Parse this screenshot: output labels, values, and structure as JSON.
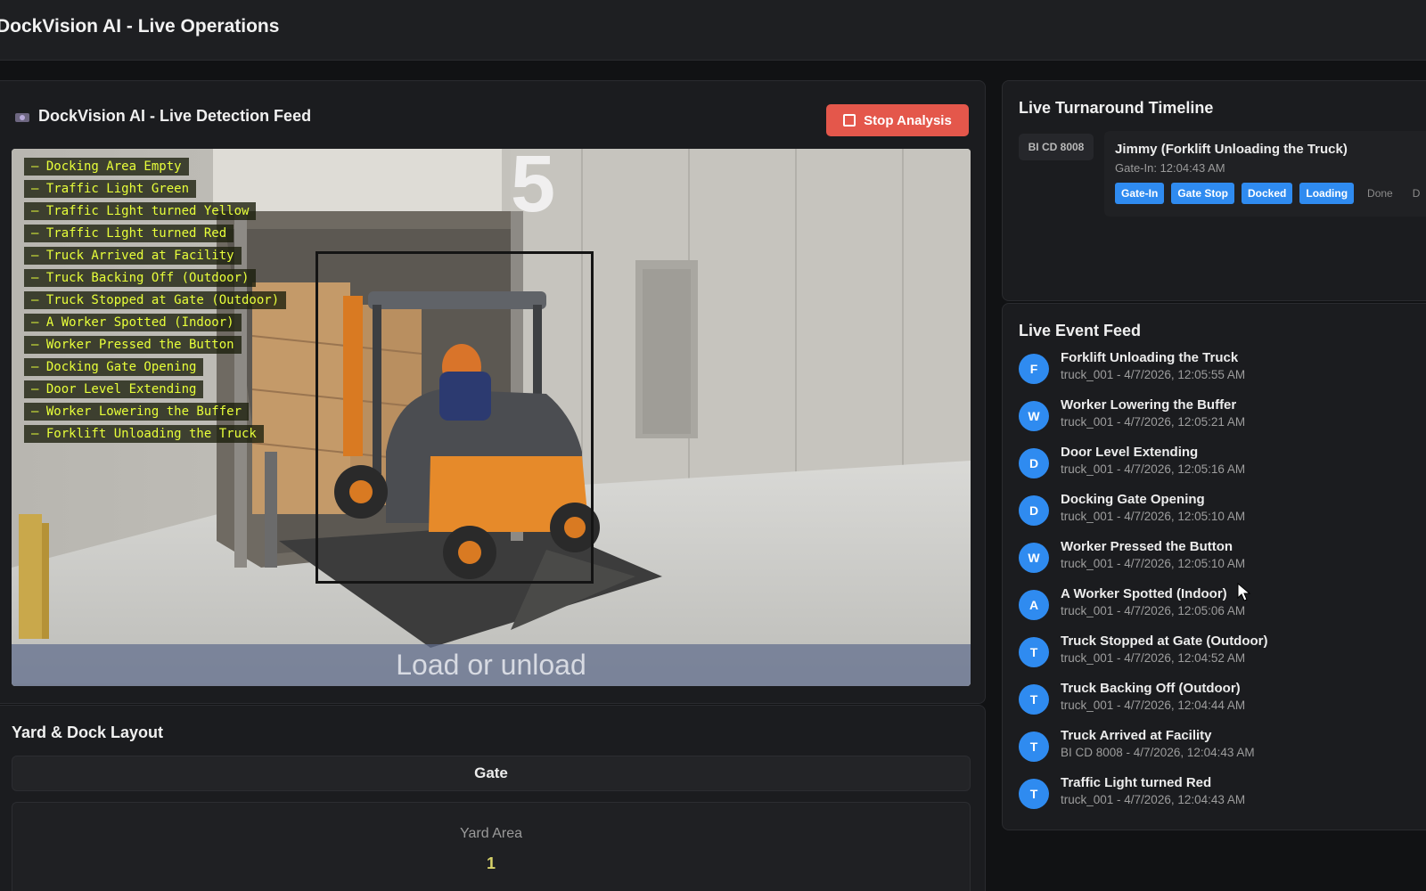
{
  "app": {
    "title": "DockVision AI - Live Operations"
  },
  "detection": {
    "title": "DockVision AI - Live Detection Feed",
    "stop_button": "Stop Analysis",
    "items": [
      "– Docking Area Empty",
      "– Traffic Light Green",
      "– Traffic Light turned Yellow",
      "– Traffic Light turned Red",
      "– Truck Arrived at Facility",
      "– Truck Backing Off (Outdoor)",
      "– Truck Stopped at Gate (Outdoor)",
      "– A Worker Spotted (Indoor)",
      "– Worker Pressed the Button",
      "– Docking Gate Opening",
      "– Door Level Extending",
      "– Worker Lowering the Buffer",
      "– Forklift Unloading the Truck"
    ],
    "bay_number": "5",
    "caption": "Load or unload"
  },
  "yard": {
    "title": "Yard & Dock Layout",
    "gate_label": "Gate",
    "area_label": "Yard Area",
    "area_count": "1"
  },
  "timeline": {
    "title": "Live Turnaround Timeline",
    "plate": "BI CD 8008",
    "entry_title": "Jimmy (Forklift Unloading the Truck)",
    "gate_in": "Gate-In: 12:04:43 AM",
    "stages": [
      {
        "label": "Gate-In",
        "active": true
      },
      {
        "label": "Gate Stop",
        "active": true
      },
      {
        "label": "Docked",
        "active": true
      },
      {
        "label": "Loading",
        "active": true
      },
      {
        "label": "Done",
        "active": false
      },
      {
        "label": "D",
        "active": false
      }
    ]
  },
  "feed": {
    "title": "Live Event Feed",
    "events": [
      {
        "initial": "F",
        "title": "Forklift Unloading the Truck",
        "meta": "truck_001 - 4/7/2026, 12:05:55 AM"
      },
      {
        "initial": "W",
        "title": "Worker Lowering the Buffer",
        "meta": "truck_001 - 4/7/2026, 12:05:21 AM"
      },
      {
        "initial": "D",
        "title": "Door Level Extending",
        "meta": "truck_001 - 4/7/2026, 12:05:16 AM"
      },
      {
        "initial": "D",
        "title": "Docking Gate Opening",
        "meta": "truck_001 - 4/7/2026, 12:05:10 AM"
      },
      {
        "initial": "W",
        "title": "Worker Pressed the Button",
        "meta": "truck_001 - 4/7/2026, 12:05:10 AM"
      },
      {
        "initial": "A",
        "title": "A Worker Spotted (Indoor)",
        "meta": "truck_001 - 4/7/2026, 12:05:06 AM"
      },
      {
        "initial": "T",
        "title": "Truck Stopped at Gate (Outdoor)",
        "meta": "truck_001 - 4/7/2026, 12:04:52 AM"
      },
      {
        "initial": "T",
        "title": "Truck Backing Off (Outdoor)",
        "meta": "truck_001 - 4/7/2026, 12:04:44 AM"
      },
      {
        "initial": "T",
        "title": "Truck Arrived at Facility",
        "meta": "BI CD 8008 - 4/7/2026, 12:04:43 AM"
      },
      {
        "initial": "T",
        "title": "Traffic Light turned Red",
        "meta": "truck_001 - 4/7/2026, 12:04:43 AM"
      }
    ]
  },
  "colors": {
    "accent": "#2f8bf0",
    "stop": "#e4574b",
    "detection_text": "#e8ff3a"
  }
}
